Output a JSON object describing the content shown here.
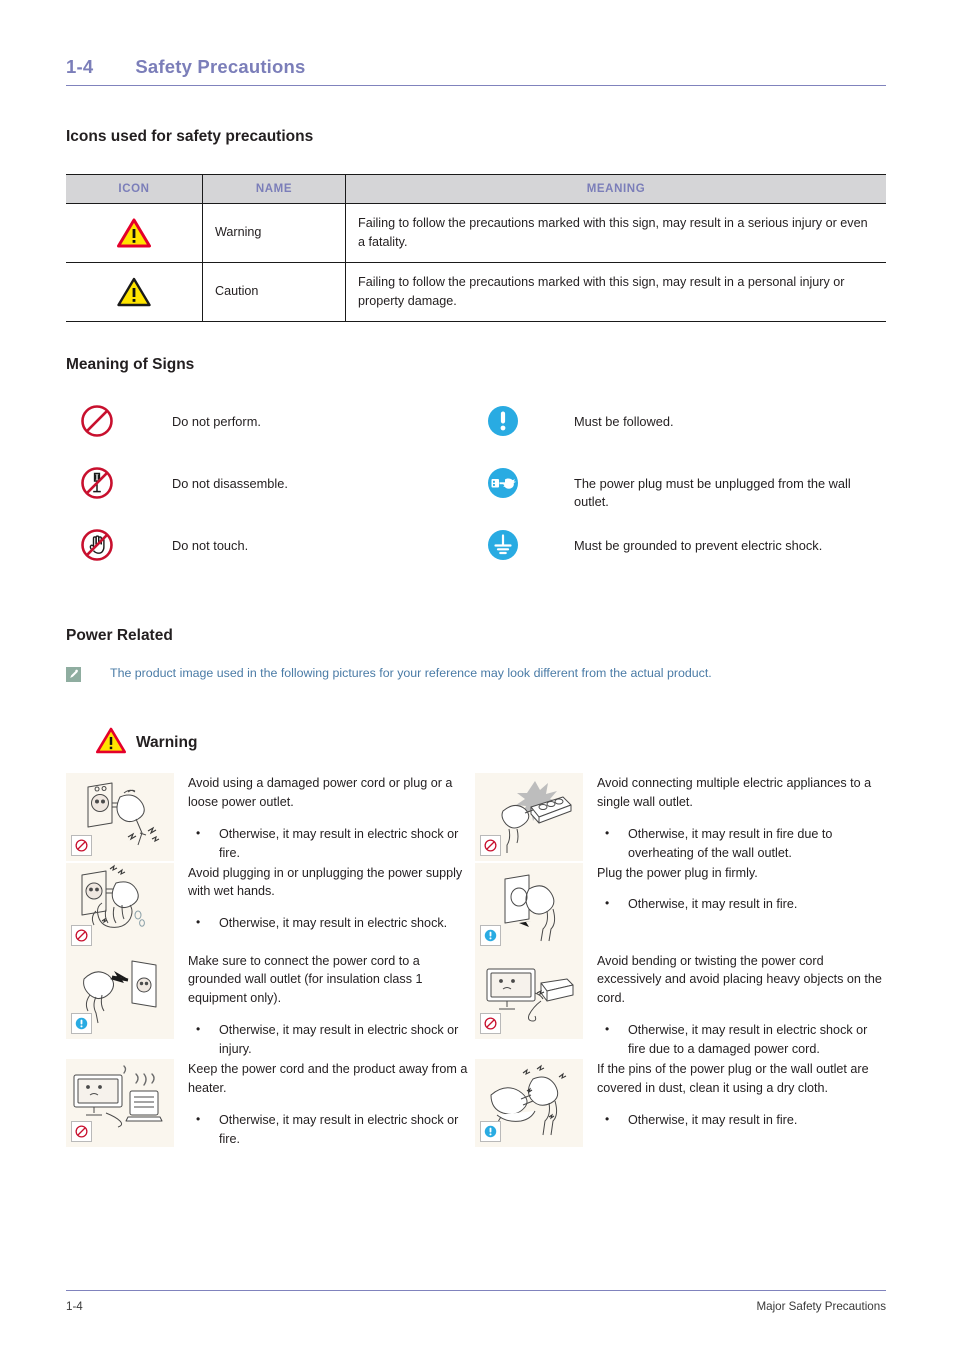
{
  "header": {
    "number": "1-4",
    "title": "Safety Precautions"
  },
  "sections": {
    "icons_title": "Icons used for safety precautions",
    "signs_title": "Meaning of Signs",
    "power_title": "Power Related"
  },
  "icon_table": {
    "columns": [
      "ICON",
      "NAME",
      "MEANING"
    ],
    "rows": [
      {
        "icon": "warning-triangle-red-icon",
        "name": "Warning",
        "meaning": "Failing to follow the precautions marked with this sign, may result in a serious injury or even a fatality."
      },
      {
        "icon": "caution-triangle-black-icon",
        "name": "Caution",
        "meaning": "Failing to follow the precautions marked with this sign, may result in a personal injury or property damage."
      }
    ]
  },
  "signs": {
    "left": [
      {
        "icon": "prohibition-circle-icon",
        "label": "Do not perform."
      },
      {
        "icon": "no-disassemble-icon",
        "label": "Do not disassemble."
      },
      {
        "icon": "no-touch-hand-icon",
        "label": "Do not touch."
      }
    ],
    "right": [
      {
        "icon": "mandatory-exclamation-icon",
        "label": "Must be followed."
      },
      {
        "icon": "unplug-power-icon",
        "label": "The power plug must be unplugged from the wall outlet."
      },
      {
        "icon": "ground-earth-icon",
        "label": "Must be grounded to prevent electric shock."
      }
    ]
  },
  "note": {
    "icon": "note-pencil-icon",
    "text": "The product image used in the following pictures for your reference may look different from the actual product."
  },
  "warning_banner": {
    "icon": "warning-triangle-red-icon",
    "label": "Warning"
  },
  "warnings": [
    {
      "figure": "damaged-plug-outlet-illustration",
      "badge": "prohibition-badge",
      "lead": "Avoid using a damaged power cord or plug or a loose power outlet.",
      "bullets": [
        "Otherwise, it may result in electric shock or fire."
      ]
    },
    {
      "figure": "multi-plug-power-strip-illustration",
      "badge": "prohibition-badge",
      "lead": "Avoid connecting multiple electric appliances to a single wall outlet.",
      "bullets": [
        "Otherwise, it may result in fire due to overheating of the wall outlet."
      ]
    },
    {
      "figure": "wet-hands-plug-illustration",
      "badge": "prohibition-badge",
      "lead": "Avoid plugging in or unplugging the power supply with wet hands.",
      "bullets": [
        "Otherwise, it may result in electric shock."
      ]
    },
    {
      "figure": "plug-in-firmly-illustration",
      "badge": "mandatory-badge",
      "lead": "Plug the power plug in firmly.",
      "bullets": [
        "Otherwise, it may result in fire."
      ]
    },
    {
      "figure": "grounded-outlet-illustration",
      "badge": "mandatory-badge",
      "lead": "Make sure to connect the power cord to a grounded wall outlet (for insulation class 1 equipment only).",
      "bullets": [
        "Otherwise, it may result in electric shock or injury."
      ]
    },
    {
      "figure": "bent-cord-heavy-object-illustration",
      "badge": "prohibition-badge",
      "lead": "Avoid bending or twisting the power cord excessively and avoid placing heavy objects on the cord.",
      "bullets": [
        "Otherwise, it may result in electric shock or fire due to a damaged power cord."
      ]
    },
    {
      "figure": "monitor-near-heater-illustration",
      "badge": "prohibition-badge",
      "lead": "Keep the power cord and the product away from a heater.",
      "bullets": [
        "Otherwise, it may result in electric shock or fire."
      ]
    },
    {
      "figure": "clean-dusty-plug-illustration",
      "badge": "mandatory-badge",
      "lead": "If the pins of the power plug or the wall outlet are covered in dust, clean it using a dry cloth.",
      "bullets": [
        "Otherwise, it may result in fire."
      ]
    }
  ],
  "footer": {
    "page_number": "1-4",
    "chapter": "Major Safety Precautions"
  },
  "colors": {
    "accent_purple": "#7b7eb9",
    "table_header_bg": "#d5d5d7",
    "note_text": "#4a7ba6",
    "prohibition_red": "#c8102e",
    "mandatory_blue": "#29abe2",
    "figure_bg": "#faf6ee",
    "warning_yellow": "#ffe400"
  }
}
